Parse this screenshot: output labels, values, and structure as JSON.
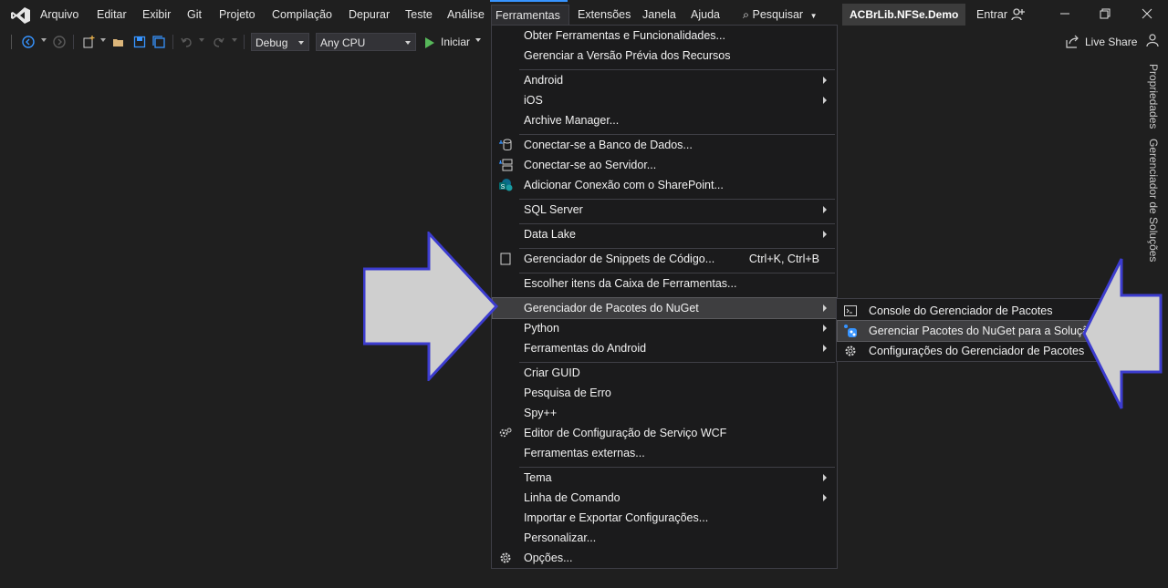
{
  "menubar": {
    "items": [
      "Arquivo",
      "Editar",
      "Exibir",
      "Git",
      "Projeto",
      "Compilação",
      "Depurar",
      "Teste",
      "Análise",
      "Ferramentas",
      "Extensões",
      "Janela",
      "Ajuda"
    ],
    "search_label": "Pesquisar",
    "solution_name": "ACBrLib.NFSe.Demo",
    "signin_label": "Entrar"
  },
  "toolbar": {
    "config": "Debug",
    "platform": "Any CPU",
    "start_label": "Iniciar",
    "live_share_label": "Live Share"
  },
  "side_tabs": {
    "properties": "Propriedades",
    "solution_explorer": "Gerenciador de Soluções"
  },
  "tools_menu": {
    "items": [
      {
        "label": "Obter Ferramentas e Funcionalidades...",
        "icon": ""
      },
      {
        "label": "Gerenciar a Versão Prévia dos Recursos",
        "icon": ""
      },
      {
        "label": "Android",
        "icon": "",
        "submenu": true
      },
      {
        "label": "iOS",
        "icon": "",
        "submenu": true
      },
      {
        "label": "Archive Manager...",
        "icon": ""
      },
      {
        "label": "Conectar-se a Banco de Dados...",
        "icon": "database-connect-icon"
      },
      {
        "label": "Conectar-se ao Servidor...",
        "icon": "server-connect-icon"
      },
      {
        "label": "Adicionar Conexão com o SharePoint...",
        "icon": "sharepoint-icon"
      },
      {
        "label": "SQL Server",
        "icon": "",
        "submenu": true
      },
      {
        "label": "Data Lake",
        "icon": "",
        "submenu": true
      },
      {
        "label": "Gerenciador de Snippets de Código...",
        "icon": "snippet-icon",
        "shortcut": "Ctrl+K, Ctrl+B"
      },
      {
        "label": "Escolher itens da Caixa de Ferramentas...",
        "icon": ""
      },
      {
        "label": "Gerenciador de Pacotes do NuGet",
        "icon": "",
        "submenu": true,
        "highlighted": true
      },
      {
        "label": "Python",
        "icon": "",
        "submenu": true
      },
      {
        "label": "Ferramentas do Android",
        "icon": "",
        "submenu": true
      },
      {
        "label": "Criar GUID",
        "icon": ""
      },
      {
        "label": "Pesquisa de Erro",
        "icon": ""
      },
      {
        "label": "Spy++",
        "icon": ""
      },
      {
        "label": "Editor de Configuração de Serviço WCF",
        "icon": "wcf-config-icon"
      },
      {
        "label": "Ferramentas externas...",
        "icon": ""
      },
      {
        "label": "Tema",
        "icon": "",
        "submenu": true
      },
      {
        "label": "Linha de Comando",
        "icon": "",
        "submenu": true
      },
      {
        "label": "Importar e Exportar Configurações...",
        "icon": ""
      },
      {
        "label": "Personalizar...",
        "icon": ""
      },
      {
        "label": "Opções...",
        "icon": "gear-icon"
      }
    ]
  },
  "nuget_submenu": {
    "items": [
      {
        "label": "Console do Gerenciador de Pacotes",
        "icon": "console-icon"
      },
      {
        "label": "Gerenciar Pacotes do NuGet para a Solução...",
        "icon": "nuget-icon",
        "highlighted": true
      },
      {
        "label": "Configurações do Gerenciador de Pacotes",
        "icon": "gear-icon"
      }
    ]
  },
  "colors": {
    "background": "#1f1f1f",
    "menu_bg": "#1b1b1c",
    "highlight": "#3e3e40",
    "accent": "#3794ff",
    "annotation_arrow_fill": "#cfcfcf",
    "annotation_arrow_stroke": "#3c3ccf"
  }
}
